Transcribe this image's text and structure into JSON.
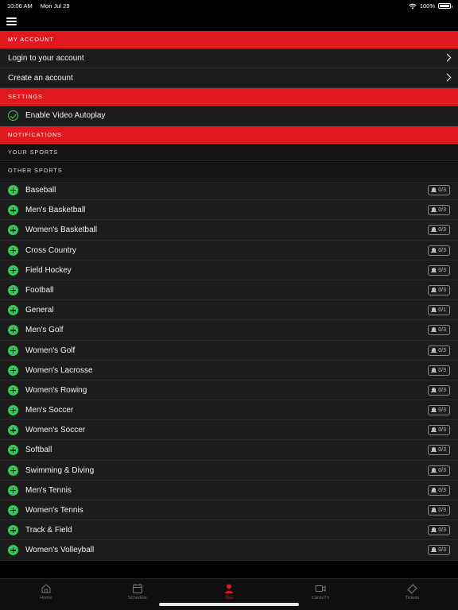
{
  "status": {
    "time": "10:06 AM",
    "date": "Mon Jul 29",
    "battery": "100%"
  },
  "sections": {
    "my_account": "MY ACCOUNT",
    "settings": "SETTINGS",
    "notifications": "NOTIFICATIONS",
    "your_sports": "YOUR SPORTS",
    "other_sports": "OTHER SPORTS"
  },
  "account": {
    "login": "Login to your account",
    "create": "Create an account"
  },
  "settings": {
    "autoplay": "Enable Video Autoplay"
  },
  "sports": [
    {
      "name": "Baseball",
      "count": "0/3"
    },
    {
      "name": "Men's Basketball",
      "count": "0/3"
    },
    {
      "name": "Women's Basketball",
      "count": "0/3"
    },
    {
      "name": "Cross Country",
      "count": "0/3"
    },
    {
      "name": "Field Hockey",
      "count": "0/3"
    },
    {
      "name": "Football",
      "count": "0/3"
    },
    {
      "name": "General",
      "count": "0/1"
    },
    {
      "name": "Men's Golf",
      "count": "0/3"
    },
    {
      "name": "Women's Golf",
      "count": "0/3"
    },
    {
      "name": "Women's Lacrosse",
      "count": "0/3"
    },
    {
      "name": "Women's Rowing",
      "count": "0/3"
    },
    {
      "name": "Men's Soccer",
      "count": "0/3"
    },
    {
      "name": "Women's Soccer",
      "count": "0/3"
    },
    {
      "name": "Softball",
      "count": "0/3"
    },
    {
      "name": "Swimming & Diving",
      "count": "0/3"
    },
    {
      "name": "Men's Tennis",
      "count": "0/3"
    },
    {
      "name": "Women's Tennis",
      "count": "0/3"
    },
    {
      "name": "Track & Field",
      "count": "0/3"
    },
    {
      "name": "Women's Volleyball",
      "count": "0/3"
    }
  ],
  "tabs": [
    {
      "label": "Home",
      "icon": "home-icon"
    },
    {
      "label": "Schedule",
      "icon": "calendar-icon"
    },
    {
      "label": "You",
      "icon": "person-icon"
    },
    {
      "label": "CardsTV",
      "icon": "video-icon"
    },
    {
      "label": "Tickets",
      "icon": "ticket-icon"
    }
  ],
  "colors": {
    "accent": "#e0191e",
    "plus": "#35c85a",
    "row_bg": "#1c1c1c"
  }
}
